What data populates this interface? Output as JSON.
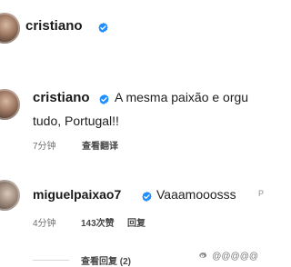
{
  "header": {
    "username": "cristiano"
  },
  "comments": [
    {
      "username": "cristiano",
      "text_line1": "A mesma paixão e orgu",
      "text_line2": "tudo, Portugal!!",
      "time": "7分钟",
      "translate": "查看翻译"
    },
    {
      "username": "miguelpaixao7",
      "text_line1": "Vaaamooosss",
      "text_suffix": "P",
      "time": "4分钟",
      "likes": "143次赞",
      "reply": "回复"
    }
  ],
  "replies": {
    "view_replies": "查看回复 (2)"
  },
  "watermark": {
    "text": "@@@@@"
  },
  "colors": {
    "verified": "#1f8fff",
    "text": "#1a1a1a",
    "meta": "#6f6f6f"
  }
}
